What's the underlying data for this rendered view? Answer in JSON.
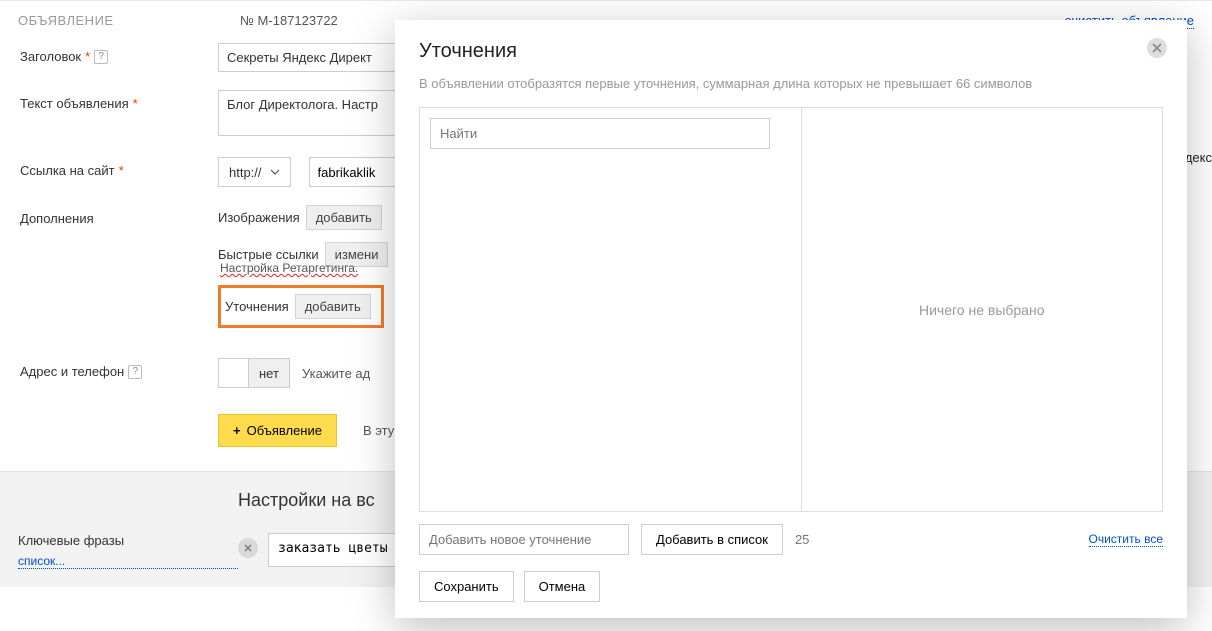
{
  "header": {
    "section_label": "ОБЪЯВЛЕНИЕ",
    "ad_number": "№ М-187123722",
    "clear_link": "очистить объявление"
  },
  "form": {
    "title_label": "Заголовок",
    "title_value": "Секреты Яндекс Директ",
    "text_label": "Текст объявления",
    "text_value": "Блог Директолога. Настр",
    "link_label": "Ссылка на сайт",
    "protocol": "http://",
    "url_value": "fabrikaklik",
    "yandex_fragment": "ндекс",
    "additions_label": "Дополнения",
    "images_label": "Изображения",
    "add_btn": "добавить",
    "quicklinks_label": "Быстрые ссылки",
    "edit_btn": "измени",
    "quicklinks_sub": "Настройка Ретаргетинга.",
    "callouts_label": "Уточнения",
    "address_label": "Адрес и телефон",
    "toggle_no": "нет",
    "address_hint": "Укажите ад",
    "add_ad_btn": "Объявление",
    "add_ad_hint": "В эту"
  },
  "bottom": {
    "heading": "Настройки на вс",
    "kw_label": "Ключевые фразы",
    "kw_link": "список...",
    "kw_value": "заказать цветы с до"
  },
  "modal": {
    "title": "Уточнения",
    "desc": "В объявлении отобразятся первые уточнения, суммарная длина которых не превышает 66 символов",
    "find_placeholder": "Найти",
    "nothing_selected": "Ничего не выбрано",
    "add_placeholder": "Добавить новое уточнение",
    "add_to_list_btn": "Добавить в список",
    "counter": "25",
    "clear_all": "Очистить все",
    "save_btn": "Сохранить",
    "cancel_btn": "Отмена"
  }
}
